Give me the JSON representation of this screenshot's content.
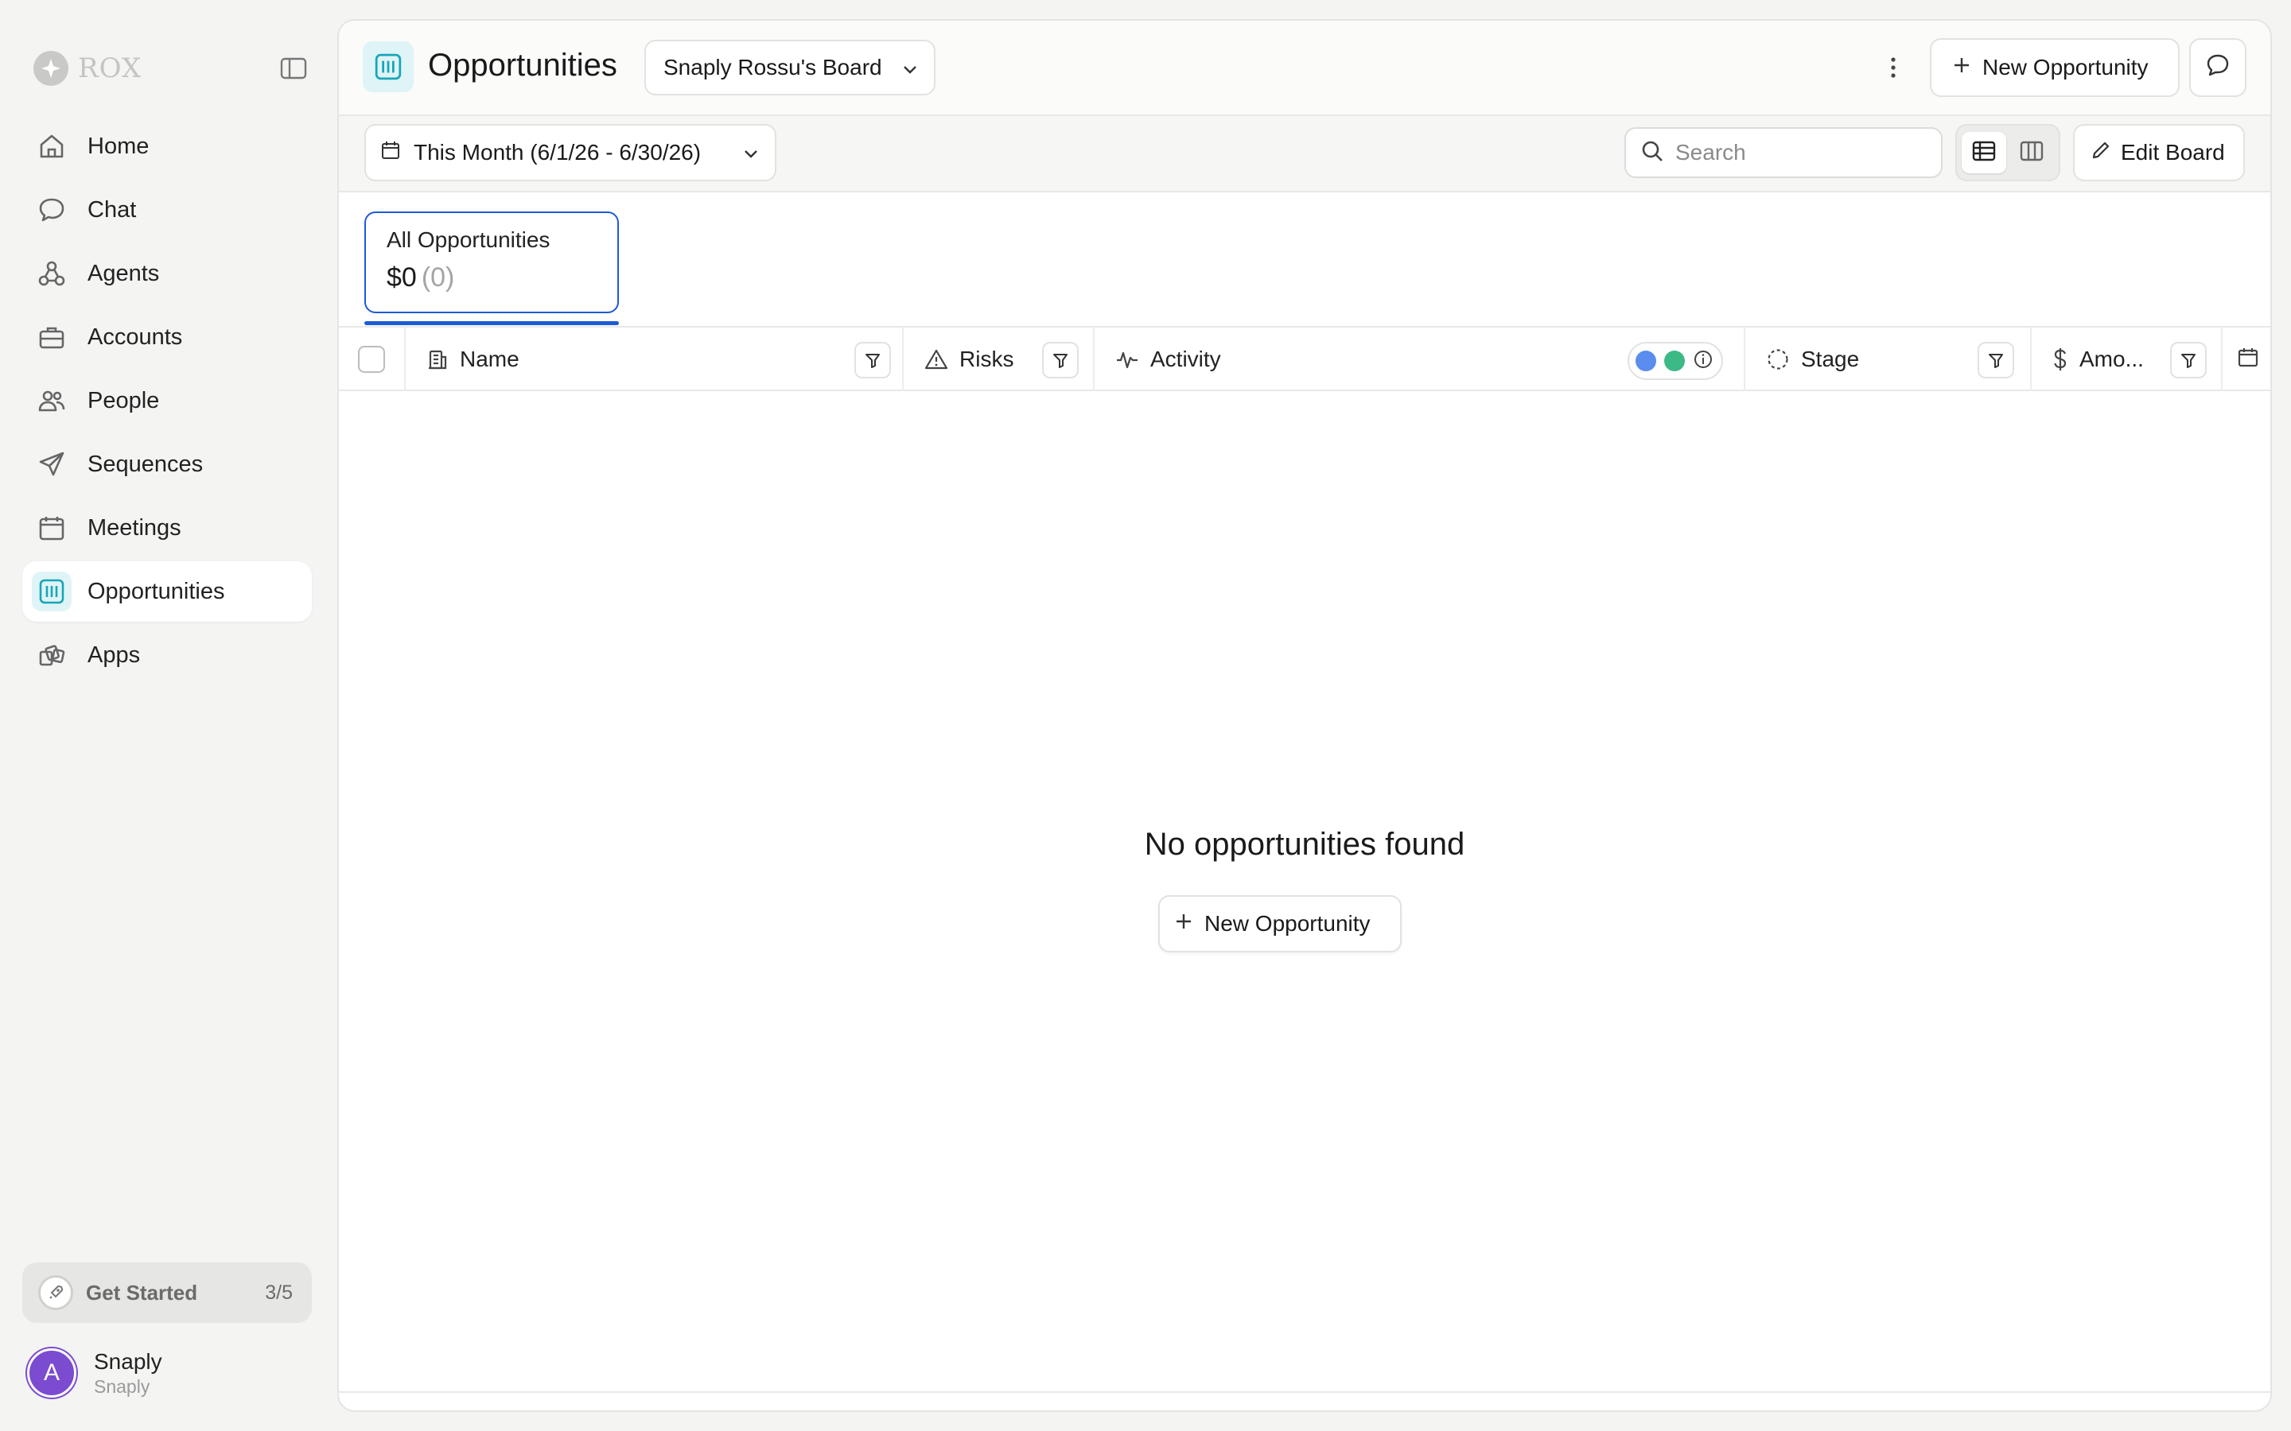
{
  "sidebar": {
    "logo_text": "ROX",
    "items": [
      {
        "label": "Home",
        "icon": "home-icon"
      },
      {
        "label": "Chat",
        "icon": "chat-bubble-icon"
      },
      {
        "label": "Agents",
        "icon": "agents-icon"
      },
      {
        "label": "Accounts",
        "icon": "briefcase-icon"
      },
      {
        "label": "People",
        "icon": "people-icon"
      },
      {
        "label": "Sequences",
        "icon": "send-icon"
      },
      {
        "label": "Meetings",
        "icon": "calendar-icon"
      },
      {
        "label": "Opportunities",
        "icon": "opportunities-icon",
        "active": true
      },
      {
        "label": "Apps",
        "icon": "apps-icon"
      }
    ],
    "get_started": {
      "label": "Get Started",
      "count": "3/5"
    },
    "user": {
      "initial": "A",
      "name": "Snaply",
      "org": "Snaply"
    }
  },
  "header": {
    "title": "Opportunities",
    "board": "Snaply Rossu's Board",
    "new_button": "New Opportunity"
  },
  "toolbar": {
    "date_range": "This Month (6/1/26 - 6/30/26)",
    "search_placeholder": "Search",
    "edit_button": "Edit Board"
  },
  "summary": {
    "title": "All Opportunities",
    "value": "$0",
    "count": "(0)"
  },
  "table": {
    "columns": [
      "Name",
      "Risks",
      "Activity",
      "Stage",
      "Amo..."
    ],
    "activity_colors": [
      "#5b8def",
      "#3cba86"
    ]
  },
  "empty_state": {
    "message": "No opportunities found",
    "button": "New Opportunity"
  },
  "colors": {
    "accent": "#1e5ad6",
    "teal": "#17a6b8",
    "avatar": "#7b4bd0"
  }
}
